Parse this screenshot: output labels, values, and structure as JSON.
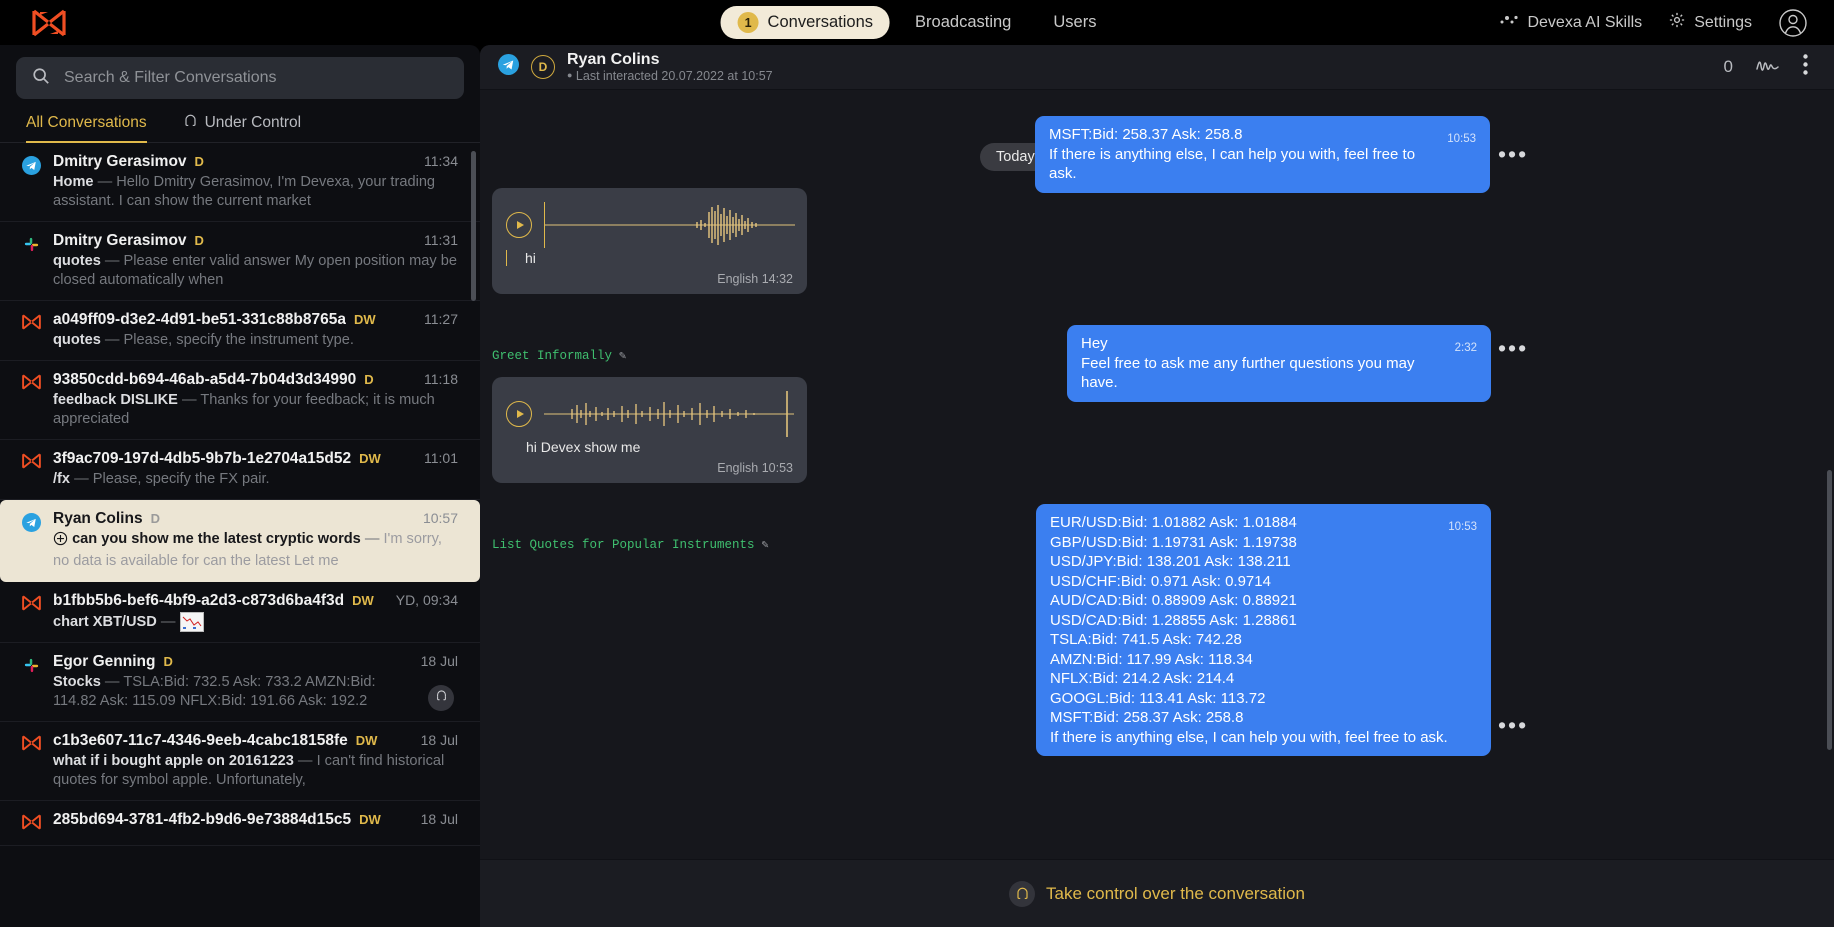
{
  "topbar": {
    "logo_icon": "devexa-logo-icon",
    "nav": [
      {
        "label": "Conversations",
        "badge": "1",
        "active": true
      },
      {
        "label": "Broadcasting",
        "badge": "",
        "active": false
      },
      {
        "label": "Users",
        "badge": "",
        "active": false
      }
    ],
    "skills_label": "Devexa AI Skills",
    "skills_icon": "sparkle-icon",
    "settings_label": "Settings",
    "settings_icon": "gear-icon",
    "avatar_icon": "user-avatar-icon"
  },
  "sidebar": {
    "search": {
      "placeholder": "Search & Filter Conversations",
      "value": "",
      "icon": "search-icon"
    },
    "tabs": [
      {
        "label": "All Conversations",
        "icon": "",
        "active": true
      },
      {
        "label": "Under Control",
        "icon": "headset-icon",
        "active": false
      }
    ],
    "conversations": [
      {
        "channel_icon": "telegram-icon",
        "name": "Dmitry Gerasimov",
        "tag": "D",
        "time": "11:34",
        "intent": "Home",
        "snippet": "Hello Dmitry Gerasimov, I'm Devexa, your trading assistant. I can show the current market",
        "selected": false
      },
      {
        "channel_icon": "slack-icon",
        "name": "Dmitry Gerasimov",
        "tag": "D",
        "time": "11:31",
        "intent": "quotes",
        "snippet": "Please enter valid answer My open position may be closed automatically when",
        "selected": false
      },
      {
        "channel_icon": "devexa-icon",
        "name": "a049ff09-d3e2-4d91-be51-331c88b8765a",
        "tag": "DW",
        "time": "11:27",
        "intent": "quotes",
        "snippet": "Please, specify the instrument type.",
        "selected": false
      },
      {
        "channel_icon": "devexa-icon",
        "name": "93850cdd-b694-46ab-a5d4-7b04d3d34990",
        "tag": "D",
        "time": "11:18",
        "intent": "feedback DISLIKE",
        "snippet": "Thanks for your feedback; it is much appreciated",
        "selected": false
      },
      {
        "channel_icon": "devexa-icon",
        "name": "3f9ac709-197d-4db5-9b7b-1e2704a15d52",
        "tag": "DW",
        "time": "11:01",
        "intent": "/fx",
        "snippet": "Please, specify the FX pair.",
        "selected": false
      },
      {
        "channel_icon": "telegram-icon",
        "name": "Ryan Colins",
        "tag": "D",
        "time": "10:57",
        "intent": "can you show me the latest cryptic words",
        "snippet": "I'm sorry, no data is available for can the latest Let me",
        "selected": true,
        "prefix_icon": "circled-plus-icon"
      },
      {
        "channel_icon": "devexa-icon",
        "name": "b1fbb5b6-bef6-4bf9-a2d3-c873d6ba4f3d",
        "tag": "DW",
        "time": "YD, 09:34",
        "intent": "chart XBT/USD",
        "snippet": "",
        "has_thumbnail": true,
        "selected": false
      },
      {
        "channel_icon": "slack-icon",
        "name": "Egor Genning",
        "tag": "D",
        "time": "18 Jul",
        "intent": "Stocks",
        "snippet": "TSLA:Bid: 732.5 Ask: 733.2 AMZN:Bid: 114.82 Ask: 115.09 NFLX:Bid: 191.66 Ask: 192.2",
        "badge_icon": "headset-icon",
        "selected": false
      },
      {
        "channel_icon": "devexa-icon",
        "name": "c1b3e607-11c7-4346-9eeb-4cabc18158fe",
        "tag": "DW",
        "time": "18 Jul",
        "intent": "what if i bought apple on 20161223",
        "snippet": "I can't find historical quotes for symbol apple. Unfortunately,",
        "selected": false
      },
      {
        "channel_icon": "devexa-icon",
        "name": "285bd694-3781-4fb2-b9d6-9e73884d15c5",
        "tag": "DW",
        "time": "18 Jul",
        "intent": "",
        "snippet": "",
        "selected": false
      }
    ]
  },
  "chat": {
    "channel_icon": "telegram-icon",
    "badge": "D",
    "name": "Ryan Colins",
    "subtitle": "Last interacted 20.07.2022 at 10:57",
    "count": "0",
    "signature_icon": "signature-icon",
    "menu_icon": "kebab-menu-icon",
    "day_divider": "Today",
    "messages": [
      {
        "type": "bubble",
        "text": "MSFT:Bid: 258.37 Ask: 258.8\nIf there is anything else, I can help you with, feel free to ask.",
        "time": "10:53"
      },
      {
        "type": "audio",
        "transcript": "hi",
        "language": "English",
        "time": "14:32",
        "intent_label": "Greet Informally",
        "edit_icon": "pencil-icon"
      },
      {
        "type": "bubble",
        "text": "Hey\nFeel free to ask me any further questions you may have.",
        "time": "2:32"
      },
      {
        "type": "audio",
        "transcript": "hi Devex show me",
        "language": "English",
        "time": "10:53",
        "intent_label": "List Quotes for Popular Instruments",
        "edit_icon": "pencil-icon"
      },
      {
        "type": "bubble",
        "text": "EUR/USD:Bid: 1.01882 Ask: 1.01884\nGBP/USD:Bid: 1.19731 Ask: 1.19738\nUSD/JPY:Bid: 138.201 Ask: 138.211\nUSD/CHF:Bid: 0.971 Ask: 0.9714\nAUD/CAD:Bid: 0.88909 Ask: 0.88921\nUSD/CAD:Bid: 1.28855 Ask: 1.28861\nTSLA:Bid: 741.5 Ask: 742.28\nAMZN:Bid: 117.99 Ask: 118.34\nNFLX:Bid: 214.2 Ask: 214.4\nGOOGL:Bid: 113.41 Ask: 113.72\nMSFT:Bid: 258.37 Ask: 258.8\nIf there is anything else, I can help you with, feel free to ask.",
        "time": "10:53"
      }
    ],
    "take_control_label": "Take control over the conversation",
    "take_control_icon": "headset-icon"
  },
  "colors": {
    "accent_gold": "#e0b94b",
    "brand_orange": "#f04e23",
    "bubble_blue": "#3b7ff0",
    "selected_cream": "#ece5d4",
    "telegram_blue": "#2aa1e0",
    "intent_green": "#3fbf6f"
  }
}
